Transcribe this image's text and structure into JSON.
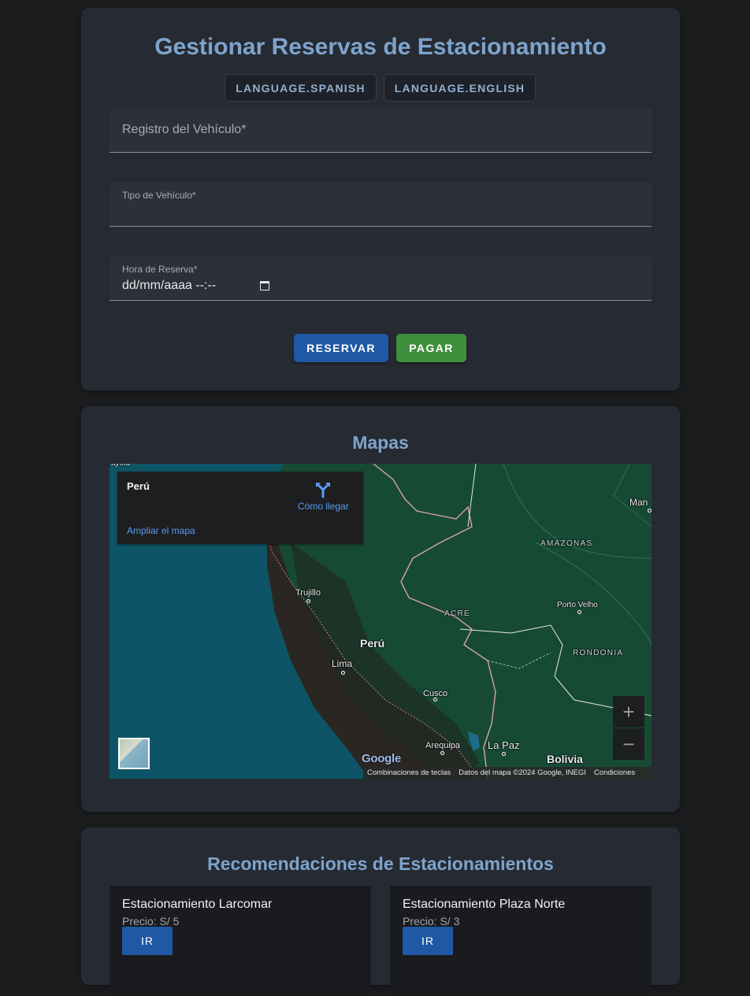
{
  "booking": {
    "title": "Gestionar Reservas de Estacionamiento",
    "lang_spanish": "LANGUAGE.SPANISH",
    "lang_english": "LANGUAGE.ENGLISH",
    "registro_placeholder": "Registro del Vehículo*",
    "tipo_label": "Tipo de Vehículo*",
    "hora_label": "Hora de Reserva*",
    "hora_value": "dd/mm/aaaa --:--",
    "reservar_label": "RESERVAR",
    "pagar_label": "PAGAR"
  },
  "maps": {
    "title": "Mapas",
    "info_title": "Perú",
    "directions_label": "Cómo llegar",
    "enlarge_label": "Ampliar el mapa",
    "zoom_in": "+",
    "zoom_out": "−",
    "google_logo": "Google",
    "footer": [
      "Combinaciones de teclas",
      "Datos del mapa ©2024 Google, INEGI",
      "Condiciones"
    ],
    "labels": {
      "peru": "Perú",
      "lima": "Lima",
      "trujillo": "Trujillo",
      "cusco": "Cusco",
      "arequipa": "Arequipa",
      "la_paz": "La Paz",
      "bolivia": "Bolivia",
      "amazonas": "AMAZONAS",
      "acre": "ACRE",
      "rondonia": "RONDONIA",
      "porto_velho": "Porto Velho",
      "manaus": "Man",
      "edge": "ayoia"
    }
  },
  "recs": {
    "title": "Recomendaciones de Estacionamientos",
    "items": [
      {
        "name": "Estacionamiento Larcomar",
        "price": "Precio: S/ 5",
        "button": "IR"
      },
      {
        "name": "Estacionamiento Plaza Norte",
        "price": "Precio: S/ 3",
        "button": "IR"
      }
    ]
  },
  "colors": {
    "accent_title": "#7ea4cc",
    "reservar": "#1f59a6",
    "pagar": "#3f8f3c",
    "card_bg": "#262a33",
    "page_bg": "#1b1c1e"
  }
}
